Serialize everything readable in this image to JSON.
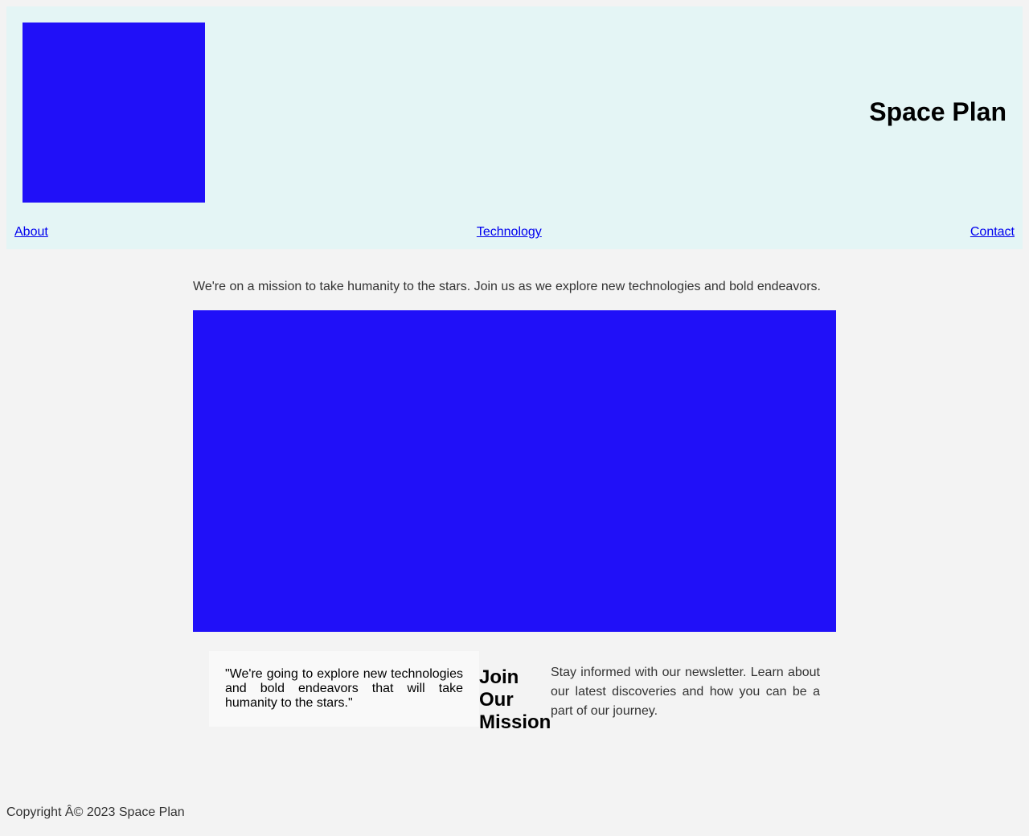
{
  "header": {
    "title": "Space Plan",
    "logo_color": "#2010f8",
    "nav": [
      {
        "label": "About"
      },
      {
        "label": "Technology"
      },
      {
        "label": "Contact"
      }
    ]
  },
  "main": {
    "intro": "We're on a mission to take humanity to the stars. Join us as we explore new technologies and bold endeavors.",
    "hero_color": "#2010f8",
    "quote": "\"We're going to explore new technologies and bold endeavors that will take humanity to the stars.\"",
    "join_heading": "Join Our Mission",
    "newsletter_text": "Stay informed with our newsletter. Learn about our latest discoveries and how you can be a part of our journey."
  },
  "footer": {
    "copyright": "Copyright Â© 2023 Space Plan"
  }
}
